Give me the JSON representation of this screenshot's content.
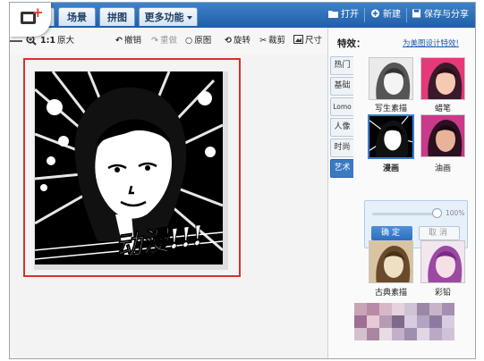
{
  "nav": {
    "tabs": [
      {
        "label": "首页"
      },
      {
        "label": "场景"
      },
      {
        "label": "拼图"
      },
      {
        "label": "更多功能"
      }
    ],
    "open_label": "打开",
    "new_label": "新建",
    "save_label": "保存与分享"
  },
  "toolbar": {
    "zoom_ratio": "1:1",
    "original_size": "原大",
    "undo": "撤销",
    "redo": "重做",
    "original_image": "原图",
    "rotate": "旋转",
    "crop": "裁剪",
    "size": "尺寸"
  },
  "panel": {
    "title": "特效：",
    "link": "为美图设计特效!",
    "categories": [
      {
        "label": "热门"
      },
      {
        "label": "基础"
      },
      {
        "label": "Lomo"
      },
      {
        "label": "人像"
      },
      {
        "label": "时尚"
      },
      {
        "label": "艺术"
      }
    ],
    "effects": [
      {
        "label": "写生素描"
      },
      {
        "label": "蜡笔"
      },
      {
        "label": "漫画"
      },
      {
        "label": "油画"
      },
      {
        "label": "古典素描"
      },
      {
        "label": "彩铅"
      }
    ],
    "slider_value": "100%",
    "confirm": "确定",
    "cancel": "取消"
  },
  "photo_caption": "动漫!!!",
  "colors": {
    "nav_bar": "#2f72bd",
    "active_category": "#3b79c0",
    "selection_frame": "#d9302a",
    "link": "#1a57b5"
  }
}
